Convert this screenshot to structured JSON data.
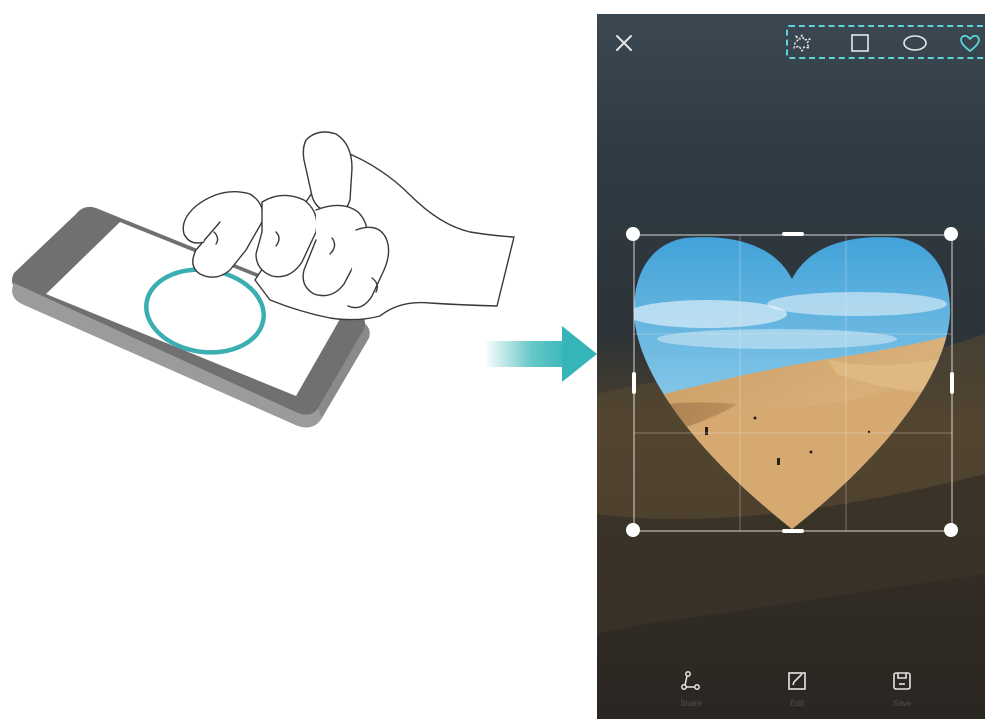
{
  "toolbar": {
    "close_icon": "close-icon",
    "shapes": [
      {
        "name": "freeform",
        "icon": "freeform-shape-icon",
        "selected": false
      },
      {
        "name": "rectangle",
        "icon": "rectangle-shape-icon",
        "selected": false
      },
      {
        "name": "oval",
        "icon": "oval-shape-icon",
        "selected": false
      },
      {
        "name": "heart",
        "icon": "heart-shape-icon",
        "selected": true
      }
    ],
    "highlight_color": "#5fd2da"
  },
  "crop": {
    "shape": "heart",
    "handle_color": "#ffffff",
    "grid": true
  },
  "bottom_actions": [
    {
      "label": "Share",
      "icon": "share-icon"
    },
    {
      "label": "Edit",
      "icon": "edit-icon"
    },
    {
      "label": "Save",
      "icon": "save-icon"
    }
  ],
  "illustration": {
    "gesture": "knuckle-draw-circle",
    "stroke_color": "#3aaeb0",
    "arrow_color": "#35b5b8"
  }
}
